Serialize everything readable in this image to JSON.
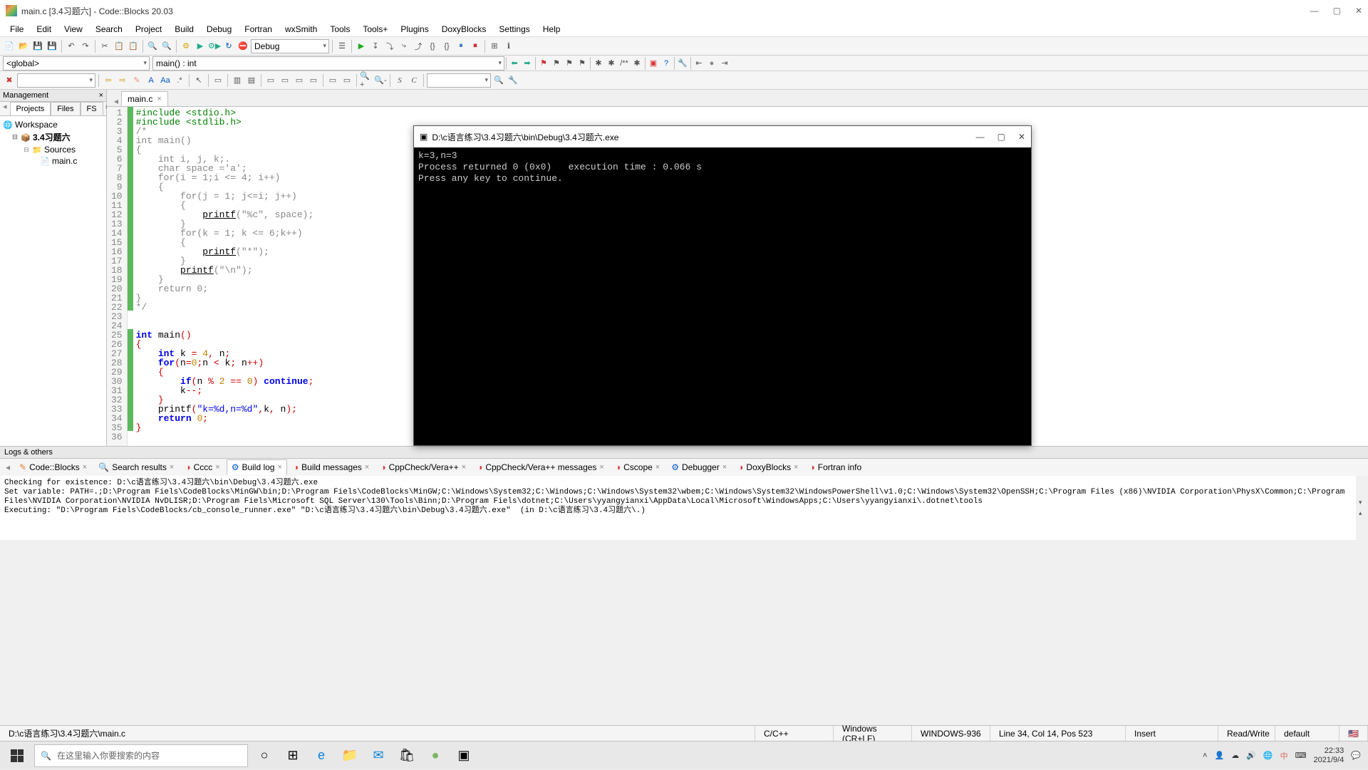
{
  "window": {
    "title": "main.c [3.4习题六] - Code::Blocks 20.03",
    "controls": {
      "min": "—",
      "max": "▢",
      "close": "✕"
    }
  },
  "menu": [
    "File",
    "Edit",
    "View",
    "Search",
    "Project",
    "Build",
    "Debug",
    "Fortran",
    "wxSmith",
    "Tools",
    "Tools+",
    "Plugins",
    "DoxyBlocks",
    "Settings",
    "Help"
  ],
  "toolbar": {
    "config": "Debug"
  },
  "context": {
    "scope": "<global>",
    "function": "main() : int"
  },
  "management": {
    "title": "Management",
    "tabs": [
      "Projects",
      "Files",
      "FS"
    ],
    "tree": {
      "workspace": "Workspace",
      "project": "3.4习题六",
      "sources": "Sources",
      "file": "main.c"
    }
  },
  "editor": {
    "tab": "main.c",
    "lines": [
      1,
      2,
      3,
      4,
      5,
      6,
      7,
      8,
      9,
      10,
      11,
      12,
      13,
      14,
      15,
      16,
      17,
      18,
      19,
      20,
      21,
      22,
      23,
      24,
      25,
      26,
      27,
      28,
      29,
      30,
      31,
      32,
      33,
      34,
      35,
      36
    ]
  },
  "logs": {
    "title": "Logs & others",
    "tabs": [
      "Code::Blocks",
      "Search results",
      "Cccc",
      "Build log",
      "Build messages",
      "CppCheck/Vera++",
      "CppCheck/Vera++ messages",
      "Cscope",
      "Debugger",
      "DoxyBlocks",
      "Fortran info"
    ],
    "active": 3,
    "body": "Checking for existence: D:\\c语言练习\\3.4习题六\\bin\\Debug\\3.4习题六.exe\nSet variable: PATH=.;D:\\Program Fiels\\CodeBlocks\\MinGW\\bin;D:\\Program Fiels\\CodeBlocks\\MinGW;C:\\Windows\\System32;C:\\Windows;C:\\Windows\\System32\\wbem;C:\\Windows\\System32\\WindowsPowerShell\\v1.0;C:\\Windows\\System32\\OpenSSH;C:\\Program Files (x86)\\NVIDIA Corporation\\PhysX\\Common;C:\\Program Files\\NVIDIA Corporation\\NVIDIA NvDLISR;D:\\Program Fiels\\Microsoft SQL Server\\130\\Tools\\Binn;D:\\Program Fiels\\dotnet;C:\\Users\\yyangyianxi\\AppData\\Local\\Microsoft\\WindowsApps;C:\\Users\\yyangyianxi\\.dotnet\\tools\nExecuting: \"D:\\Program Fiels\\CodeBlocks/cb_console_runner.exe\" \"D:\\c语言练习\\3.4习题六\\bin\\Debug\\3.4习题六.exe\"  (in D:\\c语言练习\\3.4习题六\\.)"
  },
  "statusbar": {
    "path": "D:\\c语言练习\\3.4习题六\\main.c",
    "lang": "C/C++",
    "eol": "Windows (CR+LF)",
    "enc": "WINDOWS-936",
    "pos": "Line 34, Col 14, Pos 523",
    "ins": "Insert",
    "rw": "Read/Write",
    "prof": "default"
  },
  "taskbar": {
    "search_placeholder": "在这里输入你要搜索的内容",
    "clock": {
      "time": "22:33",
      "date": "2021/9/4"
    }
  },
  "console": {
    "title": "D:\\c语言练习\\3.4习题六\\bin\\Debug\\3.4习题六.exe",
    "body": "k=3,n=3\nProcess returned 0 (0x0)   execution time : 0.066 s\nPress any key to continue."
  }
}
